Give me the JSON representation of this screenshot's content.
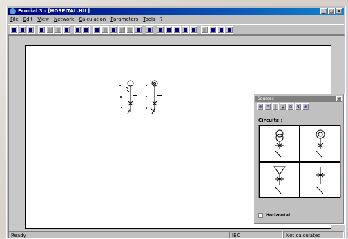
{
  "window": {
    "title": "Ecodial 3 - [HOSPITAL.HIL]"
  },
  "menu": [
    "File",
    "Edit",
    "View",
    "Network",
    "Calculation",
    "Parameters",
    "Tools",
    "?"
  ],
  "toolbar": {
    "icons": [
      "new",
      "open",
      "save",
      "draw-line",
      "cut",
      "copy",
      "paste",
      "print",
      "print-preview",
      "select",
      "zoom-window",
      "zoom-in",
      "zoom-out",
      "zoom-fit",
      "pan",
      "info",
      "check",
      "calc",
      "report",
      "grid",
      "export",
      "page",
      "label-a",
      "label-b",
      "label-c"
    ]
  },
  "palette": {
    "title": "Sources",
    "close": "x",
    "tabs": [
      "sources",
      "busbars",
      "lines",
      "earth",
      "loads",
      "switch",
      "misc"
    ],
    "circuits_label": "Circuits :",
    "horizontal_label": "Horizontal"
  },
  "status": {
    "left": "Ready",
    "middle": "IEC",
    "right": "Not calculated"
  },
  "colors": {
    "title_start": "#000080",
    "title_end": "#1084d0",
    "face": "#c0c0c0"
  }
}
